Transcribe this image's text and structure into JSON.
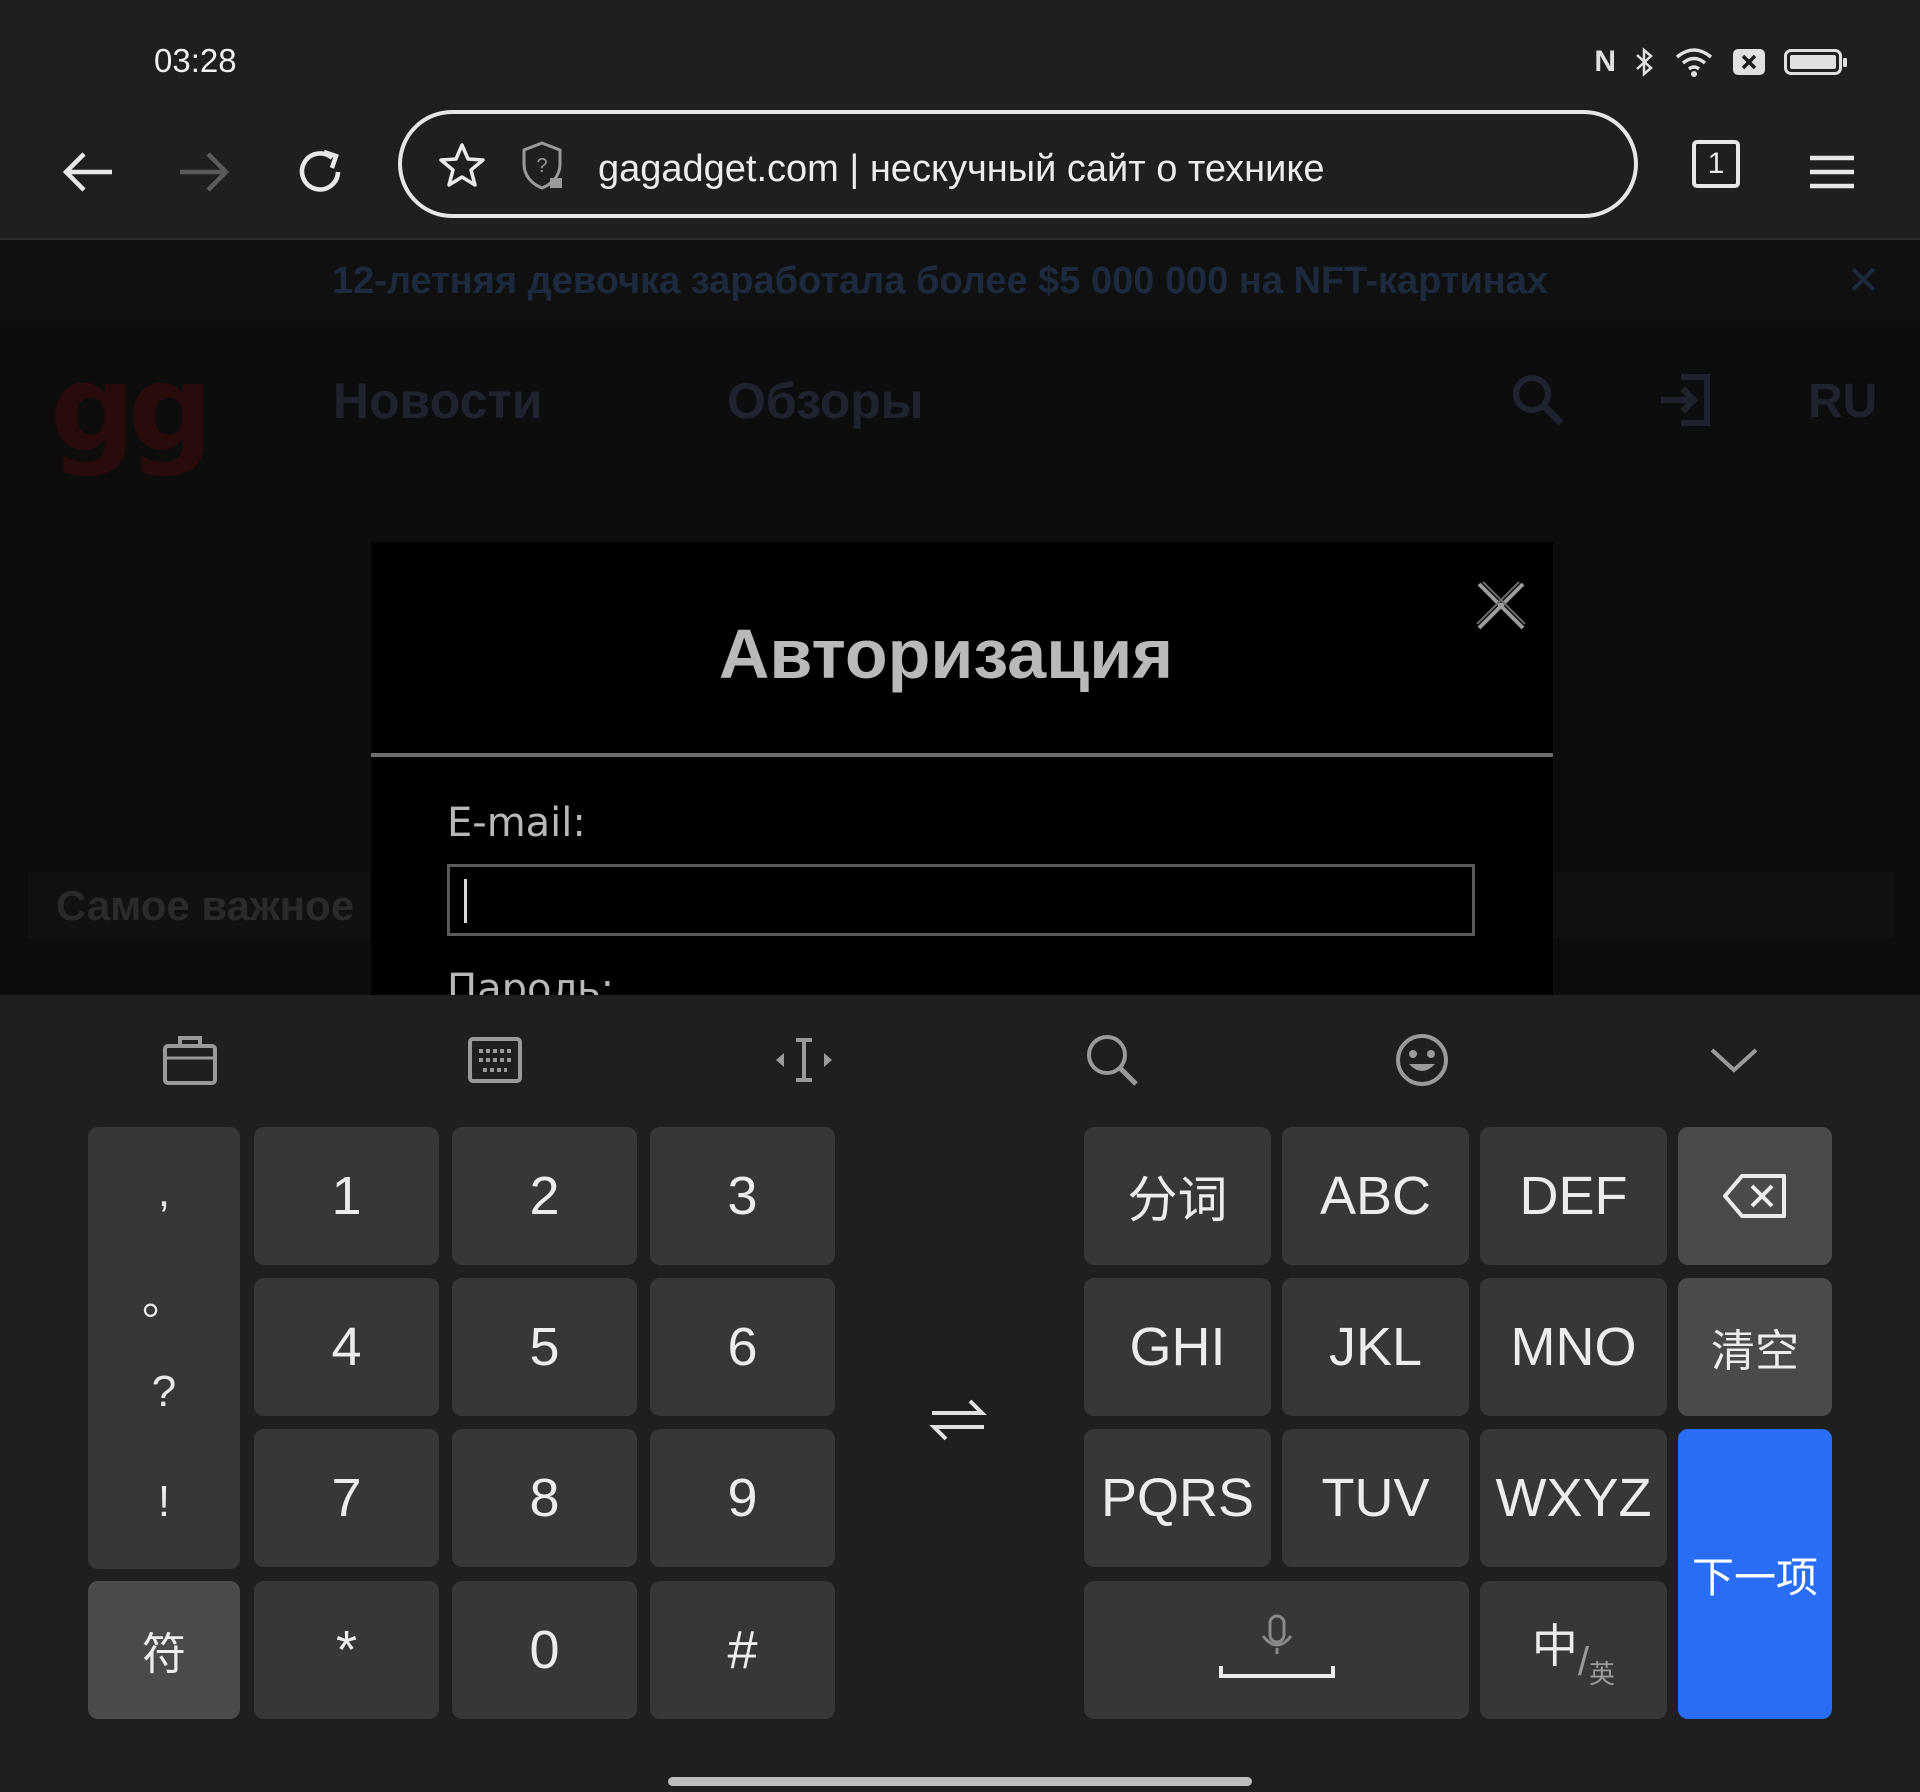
{
  "status_bar": {
    "time": "03:28",
    "icons": [
      "nfc-icon",
      "bluetooth-icon",
      "wifi-icon",
      "sim-off-icon",
      "battery-icon"
    ]
  },
  "browser": {
    "url_text": "gagadget.com | нескучный сайт о технике",
    "tab_count": "1",
    "icons": [
      "back-arrow-icon",
      "forward-arrow-icon",
      "reload-icon",
      "star-icon",
      "site-security-icon",
      "tabs-icon",
      "menu-icon"
    ]
  },
  "page": {
    "banner_text": "12-летняя девочка заработала более $5 000 000 на NFT-картинах",
    "banner_close": "✕",
    "logo": "gg",
    "nav": [
      "Новости",
      "Обзоры"
    ],
    "lang": "RU",
    "section_title": "Самое важное"
  },
  "modal": {
    "title": "Авторизация",
    "email_label": "E-mail:",
    "email_value": "",
    "password_label": "Пароль:"
  },
  "keyboard": {
    "toolbar_icons": [
      "clipboard-icon",
      "keyboard-icon",
      "cursor-move-icon",
      "search-icon",
      "emoji-icon",
      "collapse-chevron-icon"
    ],
    "punctuation": [
      ",",
      "。",
      "?",
      "!"
    ],
    "symbols_key": "符",
    "number_rows": [
      [
        "1",
        "2",
        "3"
      ],
      [
        "4",
        "5",
        "6"
      ],
      [
        "7",
        "8",
        "9"
      ],
      [
        "*",
        "0",
        "#"
      ]
    ],
    "t9_row1": [
      "分词",
      "ABC",
      "DEF"
    ],
    "t9_row2": [
      "GHI",
      "JKL",
      "MNO"
    ],
    "t9_row3": [
      "PQRS",
      "TUV",
      "WXYZ"
    ],
    "clear_key": "清空",
    "next_key": "下一项",
    "lang_key_main": "中",
    "lang_key_sub": "英",
    "accent_color": "#2a6df5"
  }
}
